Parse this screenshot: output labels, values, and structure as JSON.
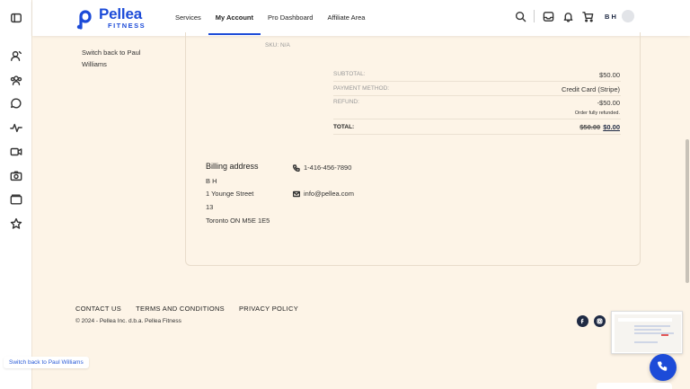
{
  "brand": {
    "name": "Pellea",
    "sub": "FITNESS",
    "color": "#1c4bd8"
  },
  "nav": {
    "items": [
      {
        "label": "Services",
        "active": false
      },
      {
        "label": "My Account",
        "active": true
      },
      {
        "label": "Pro Dashboard",
        "active": false
      },
      {
        "label": "Affiliate Area",
        "active": false
      }
    ]
  },
  "header": {
    "icons": [
      "search-icon",
      "inbox-icon",
      "bell-icon",
      "cart-icon"
    ],
    "initials": "B H"
  },
  "sidebar": {
    "icons": [
      "sidebar-toggle-icon",
      "user-icon",
      "group-icon",
      "chat-icon",
      "activity-icon",
      "video-icon",
      "camera-icon",
      "folder-icon",
      "star-icon"
    ]
  },
  "account": {
    "switch_back": "Switch back to Paul Williams"
  },
  "order": {
    "sku": "SKU: N/A",
    "subtotal_label": "SUBTOTAL:",
    "subtotal_value": "$50.00",
    "payment_label": "PAYMENT METHOD:",
    "payment_value": "Credit Card (Stripe)",
    "refund_label": "REFUND:",
    "refund_value": "-$50.00",
    "refund_note": "Order fully refunded.",
    "total_label": "TOTAL:",
    "total_old": "$50.00",
    "total_new": "$0.00"
  },
  "billing": {
    "title": "Billing address",
    "name": "B H",
    "street": "1 Younge Street",
    "unit": "13",
    "city": "Toronto ON M5E 1E5",
    "phone": "1-416-456-7890",
    "email": "info@pellea.com"
  },
  "footer": {
    "links": [
      "CONTACT US",
      "TERMS AND CONDITIONS",
      "PRIVACY POLICY"
    ],
    "copyright": "© 2024 - Pellea Inc. d.b.a. Pellea Fitness",
    "social": [
      "facebook-icon",
      "instagram-icon"
    ]
  },
  "pill": {
    "label": "Switch back to Paul Williams"
  }
}
